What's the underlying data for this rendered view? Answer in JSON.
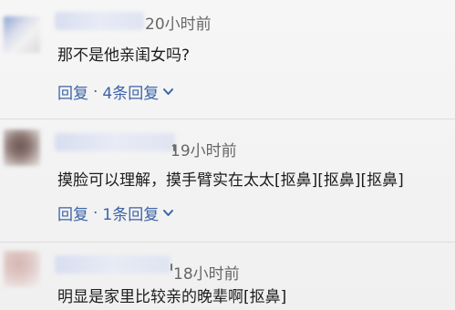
{
  "colors": {
    "background": "#f3f3f3",
    "text": "#1c1c1c",
    "meta": "#676767",
    "link": "#3c63a7",
    "divider": "#d7d7d7"
  },
  "comments": [
    {
      "time": "20小时前",
      "text": "那不是他亲闺女吗?",
      "reply_label": "回复",
      "replies_label": "4条回复",
      "chevron_icon": "chevron-down-icon"
    },
    {
      "time": "19小时前",
      "text": "摸脸可以理解，摸手臂实在太太[抠鼻][抠鼻][抠鼻]",
      "reply_label": "回复",
      "replies_label": "1条回复",
      "chevron_icon": "chevron-down-icon"
    },
    {
      "time": "18小时前",
      "text": "明显是家里比较亲的晚辈啊[抠鼻]"
    }
  ],
  "separator": "·"
}
